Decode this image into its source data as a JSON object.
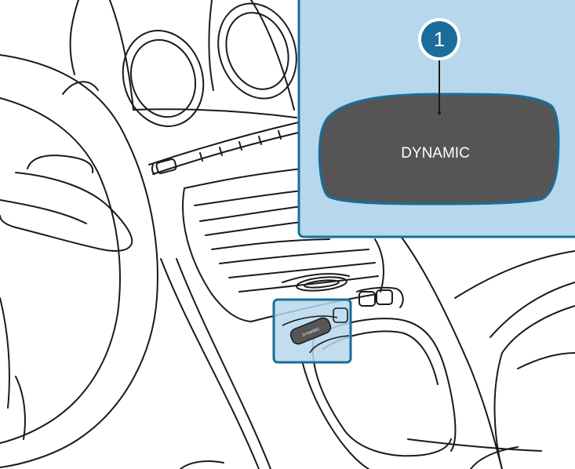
{
  "callout": {
    "marker_number": "1",
    "button_label": "DYNAMIC"
  },
  "console": {
    "small_button_label": "DYNAMIC"
  },
  "colors": {
    "highlight_fill": "#b7d7ec",
    "highlight_stroke": "#1a6d9a",
    "button_dark": "#555555",
    "line": "#1a1a1a"
  }
}
